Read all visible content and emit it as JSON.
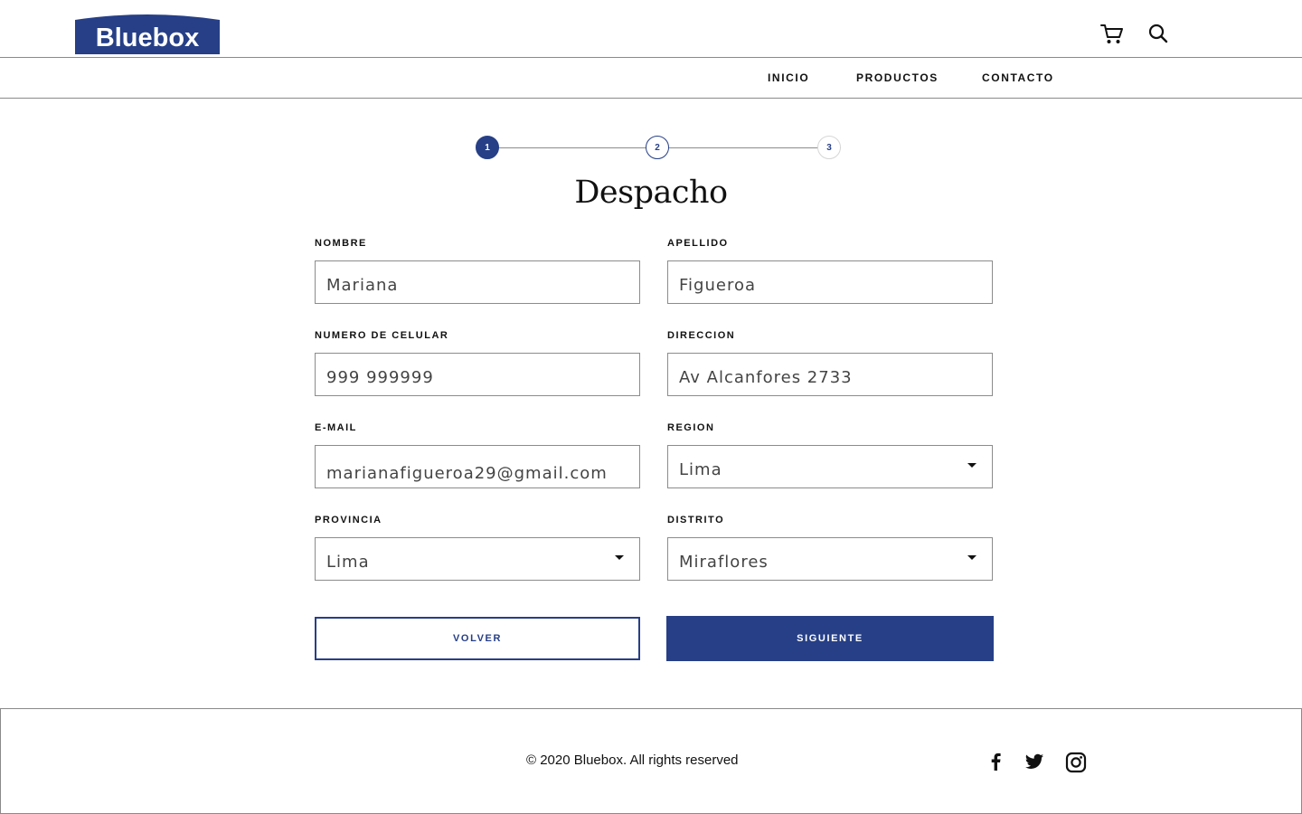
{
  "header": {
    "logo_text": "Bluebox",
    "brand_color": "#263f86",
    "icons": [
      "cart-icon",
      "search-icon"
    ]
  },
  "nav": {
    "items": [
      {
        "label": "INICIO"
      },
      {
        "label": "PRODUCTOS"
      },
      {
        "label": "CONTACTO"
      }
    ]
  },
  "stepper": {
    "steps": [
      "1",
      "2",
      "3"
    ],
    "current": 1
  },
  "form": {
    "title": "Despacho",
    "fields": {
      "nombre": {
        "label": "NOMBRE",
        "value": "Mariana"
      },
      "apellido": {
        "label": "APELLIDO",
        "value": "Figueroa"
      },
      "celular": {
        "label": "NUMERO DE CELULAR",
        "value": "999 999999"
      },
      "direccion": {
        "label": "DIRECCION",
        "value": "Av Alcanfores 2733"
      },
      "email": {
        "label": "E-MAIL",
        "value": "marianafigueroa29@gmail.com"
      },
      "region": {
        "label": "REGION",
        "value": "Lima"
      },
      "provincia": {
        "label": "PROVINCIA",
        "value": "Lima"
      },
      "distrito": {
        "label": "DISTRITO",
        "value": "Miraflores"
      }
    },
    "buttons": {
      "back": "VOLVER",
      "next": "SIGUIENTE"
    }
  },
  "footer": {
    "copyright": "© 2020 Bluebox. All rights reserved",
    "social_icons": [
      "facebook-icon",
      "twitter-icon",
      "instagram-icon"
    ]
  }
}
